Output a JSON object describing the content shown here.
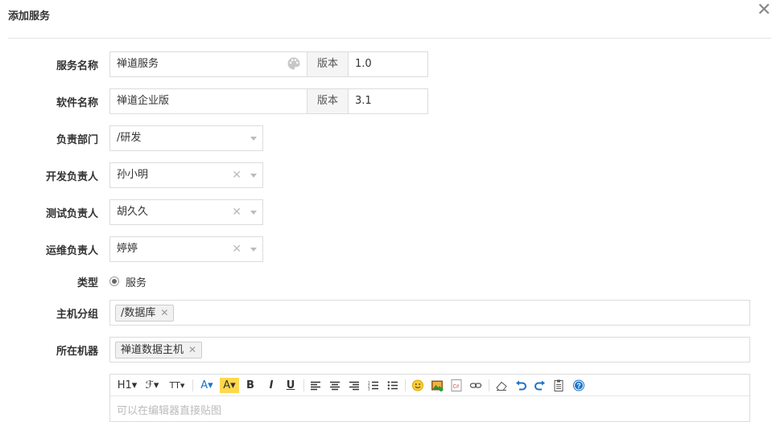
{
  "dialog": {
    "title": "添加服务",
    "close": "✕"
  },
  "form": {
    "service_name": {
      "label": "服务名称",
      "value": "禅道服务",
      "version_label": "版本",
      "version": "1.0"
    },
    "software_name": {
      "label": "软件名称",
      "value": "禅道企业版",
      "version_label": "版本",
      "version": "3.1"
    },
    "dept": {
      "label": "负责部门",
      "value": "/研发"
    },
    "dev_owner": {
      "label": "开发负责人",
      "value": "孙小明"
    },
    "test_owner": {
      "label": "测试负责人",
      "value": "胡久久"
    },
    "ops_owner": {
      "label": "运维负责人",
      "value": "婷婷"
    },
    "type": {
      "label": "类型",
      "option": "服务"
    },
    "host_group": {
      "label": "主机分组",
      "chips": [
        "/数据库"
      ]
    },
    "machine": {
      "label": "所在机器",
      "chips": [
        "禅道数据主机"
      ]
    },
    "clear_symbol": "✕",
    "chip_remove_symbol": "✕"
  },
  "editor": {
    "toolbar": {
      "h1": "H1▾",
      "font_family": "ℱ▾",
      "font_size": "TT▾",
      "font_color": "A▾",
      "bg_color": "A▾",
      "bold": "B",
      "italic": "I",
      "underline": "U"
    },
    "placeholder": "可以在编辑器直接贴图"
  },
  "colors": {
    "accent": "#1a73c8",
    "highlight": "#ffd84d",
    "border": "#dcdcdc"
  }
}
